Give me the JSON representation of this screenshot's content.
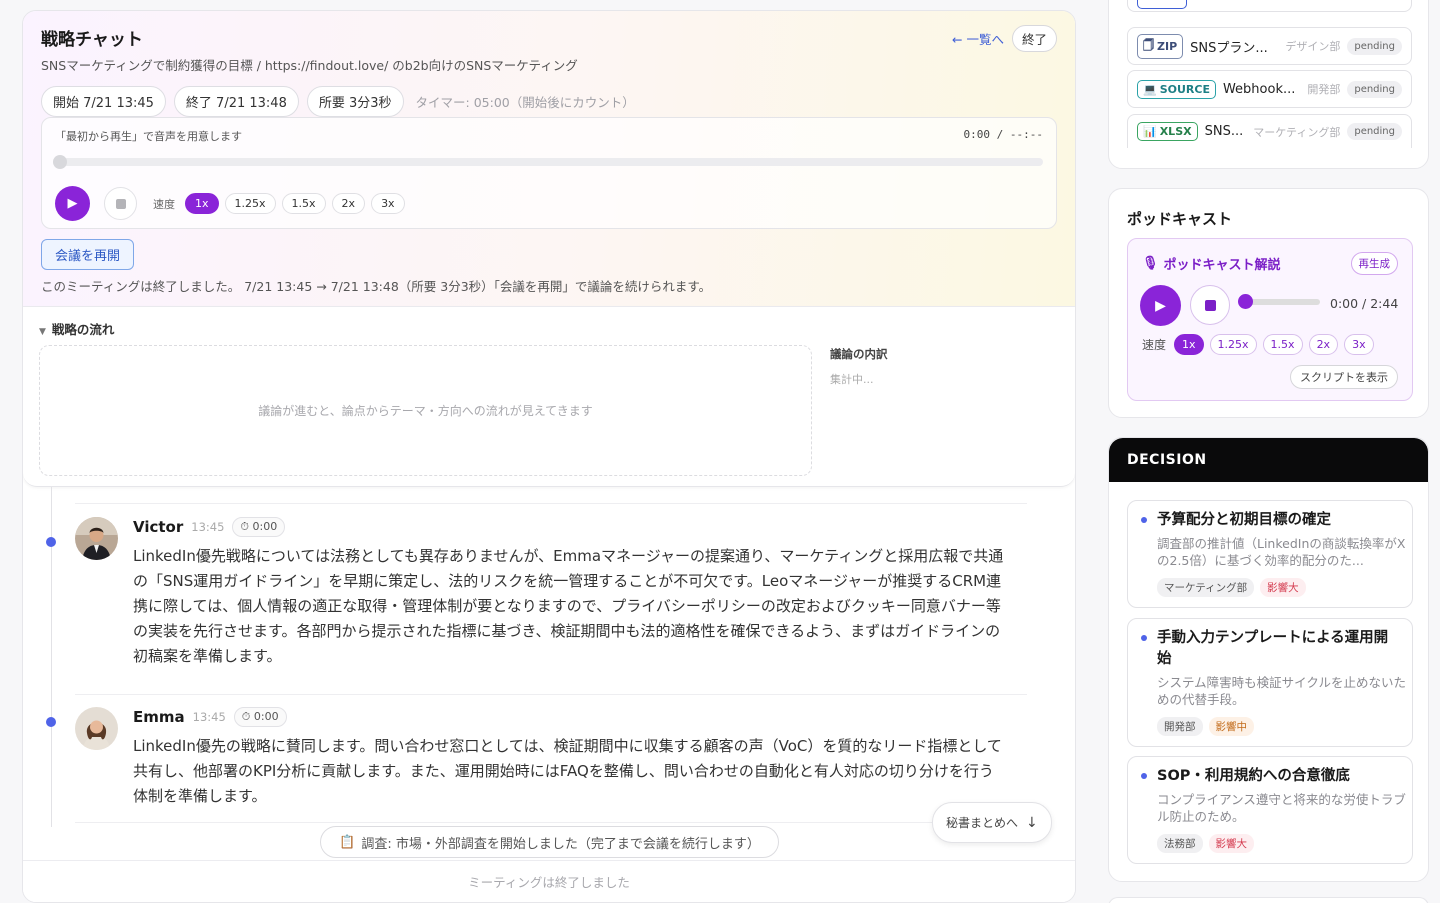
{
  "header": {
    "title": "戦略チャット",
    "subtitle": "SNSマーケティングで制約獲得の目標 / https://findout.love/ のb2b向けのSNSマーケティング",
    "back_link": "← 一覧へ",
    "end_button": "終了",
    "start_chip": "開始 7/21 13:45",
    "end_chip": "終了 7/21 13:48",
    "duration_chip": "所要 3分3秒",
    "timer_text": "タイマー: 05:00（開始後にカウント）"
  },
  "player": {
    "hint": "「最初から再生」で音声を用意します",
    "time": "0:00 / --:--",
    "progress": 0,
    "speed_label": "速度",
    "speeds": [
      "1x",
      "1.25x",
      "1.5x",
      "2x",
      "3x"
    ],
    "active_speed": "1x"
  },
  "resume_button": "会議を再開",
  "ended_message": "このミーティングは終了しました。 7/21 13:45 → 7/21 13:48（所要 3分3秒）「会議を再開」で議論を続けられます。",
  "flow": {
    "title": "戦略の流れ",
    "placeholder": "議論が進むと、論点からテーマ・方向への流れが見えてきます",
    "breakdown_title": "議論の内訳",
    "breakdown_status": "集計中..."
  },
  "messages": [
    {
      "name": "Victor",
      "time": "13:45",
      "duration": "0:00",
      "body": "LinkedIn優先戦略については法務としても異存ありませんが、Emmaマネージャーの提案通り、マーケティングと採用広報で共通の「SNS運用ガイドライン」を早期に策定し、法的リスクを統一管理することが不可欠です。Leoマネージャーが推奨するCRM連携に際しては、個人情報の適正な取得・管理体制が要となりますので、プライバシーポリシーの改定およびクッキー同意バナー等の実装を先行させます。各部門から提示された指標に基づき、検証期間中も法的適格性を確保できるよう、まずはガイドラインの初稿案を準備します。"
    },
    {
      "name": "Emma",
      "time": "13:45",
      "duration": "0:00",
      "body": "LinkedIn優先の戦略に賛同します。問い合わせ窓口としては、検証期間中に収集する顧客の声（VoC）を質的なリード指標として共有し、他部署のKPI分析に貢献します。また、運用開始時にはFAQを整備し、問い合わせの自動化と有人対応の切り分けを行う体制を準備します。"
    }
  ],
  "research_status": "調査: 市場・外部調査を開始しました（完了まで会議を続行します）",
  "summary_button": "秘書まとめへ",
  "footer_text": "ミーティングは終了しました",
  "files": [
    {
      "type": "ZIP",
      "name": "SNSプラン...",
      "dept": "デザイン部",
      "status": "pending"
    },
    {
      "type": "SOURCE",
      "name": "Webhook...",
      "dept": "開発部",
      "status": "pending"
    },
    {
      "type": "XLSX",
      "name": "SNS...",
      "dept": "マーケティング部",
      "status": "pending"
    }
  ],
  "podcast": {
    "section_title": "ポッドキャスト",
    "name": "ポッドキャスト解説",
    "regen_button": "再生成",
    "time": "0:00 / 2:44",
    "progress": 0,
    "speed_label": "速度",
    "speeds": [
      "1x",
      "1.25x",
      "1.5x",
      "2x",
      "3x"
    ],
    "active_speed": "1x",
    "script_button": "スクリプトを表示"
  },
  "decision": {
    "header": "DECISION",
    "items": [
      {
        "title": "予算配分と初期目標の確定",
        "desc": "調査部の推計値（LinkedInの商談転換率がXの2.5倍）に基づく効率的配分のた...",
        "tags": [
          "マーケティング部",
          "影響大"
        ]
      },
      {
        "title": "手動入力テンプレートによる運用開始",
        "desc": "システム障害時も検証サイクルを止めないための代替手段。",
        "tags": [
          "開発部",
          "影響中"
        ]
      },
      {
        "title": "SOP・利用規約への合意徹底",
        "desc": "コンプライアンス遵守と将来的な労使トラブル防止のため。",
        "tags": [
          "法務部",
          "影響大"
        ]
      }
    ]
  },
  "colors": {
    "accent_purple": "#8a24d8",
    "link_blue": "#3f5fd6",
    "timeline_dot": "#4f63e8",
    "impact_high": "#d43a4e",
    "impact_mid": "#c26b1a"
  }
}
